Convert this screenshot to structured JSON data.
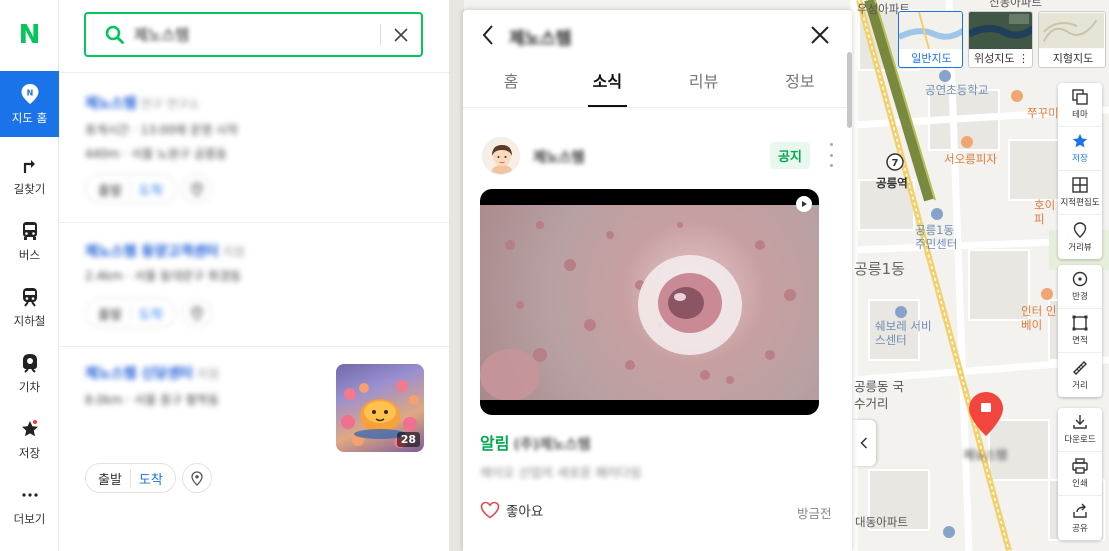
{
  "rail": {
    "logo": "N",
    "items": [
      {
        "label": "지도 홈",
        "icon": "map-pin-icon",
        "active": true
      },
      {
        "label": "길찾기",
        "icon": "directions-icon"
      },
      {
        "label": "버스",
        "icon": "bus-icon"
      },
      {
        "label": "지하철",
        "icon": "subway-icon"
      },
      {
        "label": "기차",
        "icon": "train-icon"
      },
      {
        "label": "저장",
        "icon": "star-icon"
      },
      {
        "label": "더보기",
        "icon": "more-icon"
      }
    ]
  },
  "search": {
    "query": "제노스템"
  },
  "results": [
    {
      "title": "제노스템",
      "category": "연구 연구소",
      "line1": "휴게시간 · 13:00에 운영 시작",
      "line2": "440m · 서울 노원구 공릉동",
      "depart": "출발",
      "arrive": "도착"
    },
    {
      "title": "제노스템 동양고객센터",
      "category": "지점",
      "line1": "2.4km · 서울 동대문구 휘경동",
      "depart": "출발",
      "arrive": "도착"
    },
    {
      "title": "제노스템 신당센터",
      "category": "지점",
      "line1": "8.0km · 서울 중구 황학동",
      "depart": "출발",
      "arrive": "도착",
      "thumb_count": "28"
    }
  ],
  "detail": {
    "title": "제노스템",
    "tabs": [
      "홈",
      "소식",
      "리뷰",
      "정보"
    ],
    "active_tab": "소식",
    "post": {
      "author": "제노스템",
      "badge": "공지",
      "notice_label": "알림",
      "notice_source": "(주)제노스템",
      "body": "제이오 산업의 새로운 패러다임",
      "like_label": "좋아요",
      "time": "방금전"
    }
  },
  "map": {
    "types": [
      {
        "label": "일반지도",
        "selected": true
      },
      {
        "label": "위성지도 ⋮"
      },
      {
        "label": "지형지도"
      }
    ],
    "tools_group1": [
      {
        "label": "테마",
        "icon": "layers-icon"
      },
      {
        "label": "저장",
        "icon": "star-icon"
      },
      {
        "label": "지적편집도",
        "icon": "grid-icon"
      },
      {
        "label": "거리뷰",
        "icon": "streetview-icon"
      }
    ],
    "tools_group2": [
      {
        "label": "반경",
        "icon": "radius-icon"
      },
      {
        "label": "면적",
        "icon": "area-icon"
      },
      {
        "label": "거리",
        "icon": "ruler-icon"
      }
    ],
    "tools_group3": [
      {
        "label": "다운로드",
        "icon": "download-icon"
      },
      {
        "label": "인쇄",
        "icon": "print-icon"
      },
      {
        "label": "공유",
        "icon": "share-icon"
      }
    ],
    "labels": {
      "l1": "우성아파트",
      "l2": "공연초등학교",
      "l3": "쭈꾸미도사",
      "l4": "서오릉피자",
      "l5": "공릉역",
      "l6": "공릉1동 주민센터",
      "l7": "공릉1동",
      "l8": "호이 커피",
      "l9": "인터 인베이",
      "l10": "쉐보레 서비스센터",
      "l11": "공릉동 국수거리",
      "l12": "대동아파트",
      "l13": "신동아파트",
      "station_num": "7"
    },
    "marker_label": "제노스템"
  },
  "colors": {
    "brand": "#03c75a",
    "accent": "#1a73e8",
    "marker": "#f2453d"
  }
}
